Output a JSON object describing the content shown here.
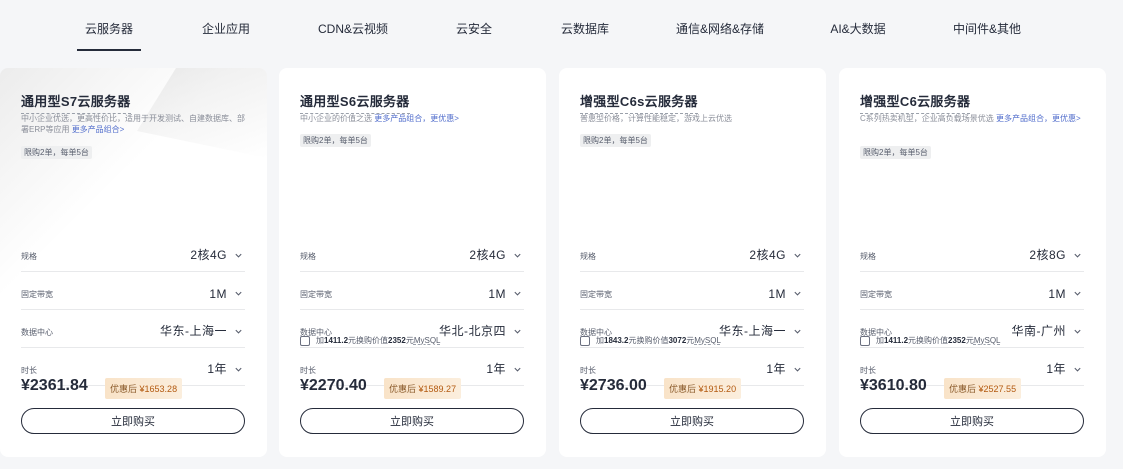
{
  "tabs": [
    {
      "label": "云服务器",
      "active": true
    },
    {
      "label": "企业应用"
    },
    {
      "label": "CDN&云视频"
    },
    {
      "label": "云安全"
    },
    {
      "label": "云数据库"
    },
    {
      "label": "通信&网络&存储"
    },
    {
      "label": "AI&大数据"
    },
    {
      "label": "中间件&其他"
    }
  ],
  "cards": [
    {
      "title": "通用型S7云服务器",
      "desc": "中小企业优选，更高性价比，适用于开发测试、自建数据库、部署ERP等应用",
      "more_link": "更多产品组合>",
      "limit": "限购2单，每单5台",
      "spec_label": "规格",
      "spec_value": "2核4G",
      "bandwidth_label": "固定带宽",
      "bandwidth_value": "1M",
      "dc_label": "数据中心",
      "dc_value": "华东-上海一",
      "duration_label": "时长",
      "duration_value": "1年",
      "price": "¥2361.84",
      "discount_label": "优惠后",
      "discount_value": "¥1653.28",
      "buy_label": "立即购买"
    },
    {
      "title": "通用型S6云服务器",
      "desc": "中小企业的价值之选",
      "more_link": "更多产品组合，更优惠>",
      "limit": "限购2单，每单5台",
      "spec_label": "规格",
      "spec_value": "2核4G",
      "bandwidth_label": "固定带宽",
      "bandwidth_value": "1M",
      "dc_label": "数据中心",
      "dc_value": "华北-北京四",
      "duration_label": "时长",
      "duration_value": "1年",
      "addon_prefix": "加",
      "addon_price": "1411.2",
      "addon_mid": "元换购价值",
      "addon_value": "2352",
      "addon_suffix": "元",
      "addon_product": "MySQL",
      "price": "¥2270.40",
      "discount_label": "优惠后",
      "discount_value": "¥1589.27",
      "buy_label": "立即购买"
    },
    {
      "title": "增强型C6s云服务器",
      "desc": "普惠型价格，计算性能稳定，游戏上云优选",
      "more_link": "",
      "limit": "限购2单，每单5台",
      "spec_label": "规格",
      "spec_value": "2核4G",
      "bandwidth_label": "固定带宽",
      "bandwidth_value": "1M",
      "dc_label": "数据中心",
      "dc_value": "华东-上海一",
      "duration_label": "时长",
      "duration_value": "1年",
      "addon_prefix": "加",
      "addon_price": "1843.2",
      "addon_mid": "元换购价值",
      "addon_value": "3072",
      "addon_suffix": "元",
      "addon_product": "MySQL",
      "price": "¥2736.00",
      "discount_label": "优惠后",
      "discount_value": "¥1915.20",
      "buy_label": "立即购买"
    },
    {
      "title": "增强型C6云服务器",
      "desc": "C系列热卖机型，企业高负载场景优选",
      "more_link": "更多产品组合，更优惠>",
      "limit": "限购2单，每单5台",
      "spec_label": "规格",
      "spec_value": "2核8G",
      "bandwidth_label": "固定带宽",
      "bandwidth_value": "1M",
      "dc_label": "数据中心",
      "dc_value": "华南-广州",
      "duration_label": "时长",
      "duration_value": "1年",
      "addon_prefix": "加",
      "addon_price": "1411.2",
      "addon_mid": "元换购价值",
      "addon_value": "2352",
      "addon_suffix": "元",
      "addon_product": "MySQL",
      "price": "¥3610.80",
      "discount_label": "优惠后",
      "discount_value": "¥2527.55",
      "buy_label": "立即购买"
    }
  ]
}
